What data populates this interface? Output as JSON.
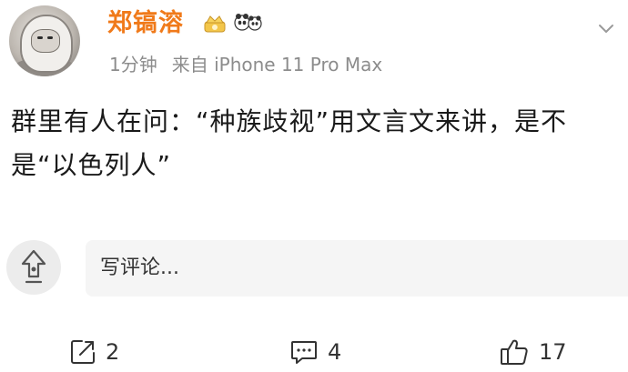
{
  "post": {
    "author": "郑镐溶",
    "time": "1分钟",
    "source": "来自 iPhone 11 Pro Max",
    "text": "群里有人在问：“种族歧视”用文言文来讲，是不是“以色列人”"
  },
  "comment_box": {
    "placeholder": "写评论..."
  },
  "actions": {
    "repost_count": "2",
    "comment_count": "4",
    "like_count": "17"
  },
  "icons": {
    "avatar": "user-avatar",
    "crown_badge": "crown-badge-icon",
    "panda_badge": "panda-badge-icon",
    "more": "chevron-down-icon",
    "repost": "repost-icon",
    "comment": "comment-icon",
    "like": "thumbs-up-icon",
    "comment_avatar": "repost-arrow-icon"
  },
  "colors": {
    "username": "#f07a1a",
    "meta": "#8c8c8c",
    "text": "#1a1a1a",
    "input_bg": "#f5f5f5"
  }
}
